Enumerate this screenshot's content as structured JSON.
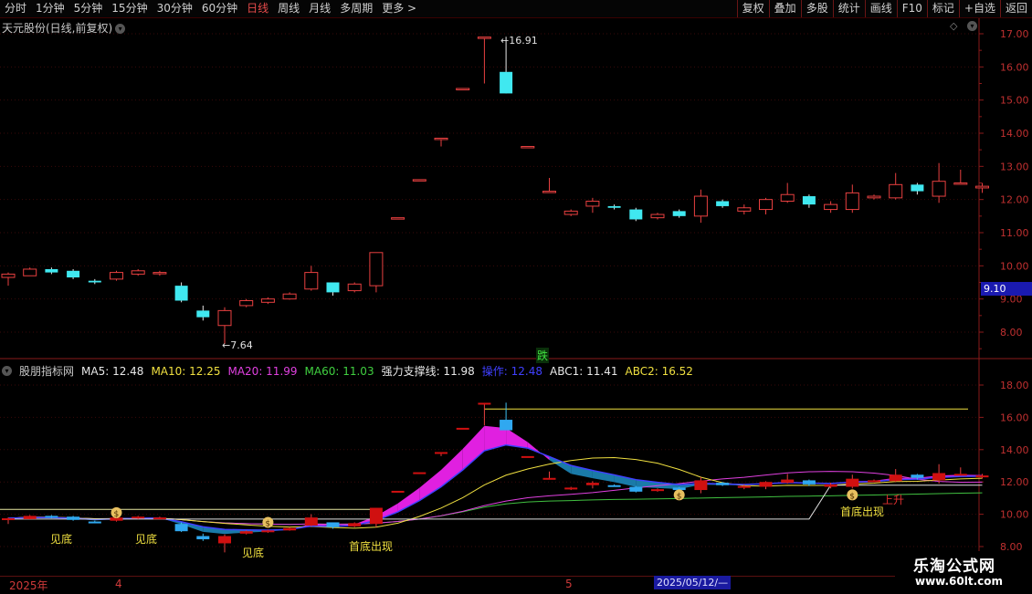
{
  "toolbar": {
    "periods": [
      "分时",
      "1分钟",
      "5分钟",
      "15分钟",
      "30分钟",
      "60分钟",
      "日线",
      "周线",
      "月线",
      "多周期",
      "更多 >"
    ],
    "active_period": "日线",
    "actions": [
      "复权",
      "叠加",
      "多股",
      "统计",
      "画线",
      "F10",
      "标记",
      "+自选",
      "返回"
    ]
  },
  "price_pane": {
    "title": "天元股份(日线,前复权)",
    "y_ticks": [
      "17.00",
      "16.00",
      "15.00",
      "14.00",
      "13.00",
      "12.00",
      "11.00",
      "10.00",
      "9.00",
      "8.00"
    ],
    "high_label": "16.91",
    "low_label": "7.64",
    "current_price": "9.10",
    "signal_text": "跌"
  },
  "indicator_pane": {
    "name": "股朋指标网",
    "values": [
      {
        "label": "MA5: 12.48",
        "color": "#e8e8e8"
      },
      {
        "label": "MA10: 12.25",
        "color": "#f0e040"
      },
      {
        "label": "MA20: 11.99",
        "color": "#e040e0"
      },
      {
        "label": "MA60: 11.03",
        "color": "#40d040"
      },
      {
        "label": "强力支撑线: 11.98",
        "color": "#e8e8e8"
      },
      {
        "label": "操作: 12.48",
        "color": "#4040ff"
      },
      {
        "label": "ABC1: 11.41",
        "color": "#e8e8e8"
      },
      {
        "label": "ABC2: 16.52",
        "color": "#f0e040"
      }
    ],
    "y_ticks": [
      "18.00",
      "16.00",
      "14.00",
      "12.00",
      "10.00",
      "8.00"
    ],
    "signals": [
      {
        "text": "见底",
        "color": "#f0e040"
      },
      {
        "text": "见底",
        "color": "#f0e040"
      },
      {
        "text": "见底",
        "color": "#f0e040"
      },
      {
        "text": "首底出现",
        "color": "#f0e040"
      },
      {
        "text": "首底出现",
        "color": "#f0e040"
      },
      {
        "text": "上升",
        "color": "#e03030"
      }
    ]
  },
  "date_bar": {
    "labels": [
      "2025年",
      "4",
      "5"
    ],
    "highlight": "2025/05/12/—"
  },
  "logo": {
    "line1": "乐淘公式网",
    "line2": "www.60lt.com"
  },
  "chart_data": {
    "type": "candlestick",
    "ylim": [
      7.5,
      17.3
    ],
    "candles": [
      {
        "o": 9.65,
        "h": 9.8,
        "l": 9.4,
        "c": 9.75
      },
      {
        "o": 9.7,
        "h": 9.95,
        "l": 9.7,
        "c": 9.9
      },
      {
        "o": 9.9,
        "h": 9.95,
        "l": 9.75,
        "c": 9.8
      },
      {
        "o": 9.85,
        "h": 9.9,
        "l": 9.6,
        "c": 9.65
      },
      {
        "o": 9.55,
        "h": 9.6,
        "l": 9.45,
        "c": 9.5
      },
      {
        "o": 9.6,
        "h": 9.85,
        "l": 9.55,
        "c": 9.8
      },
      {
        "o": 9.75,
        "h": 9.9,
        "l": 9.7,
        "c": 9.85
      },
      {
        "o": 9.8,
        "h": 9.85,
        "l": 9.7,
        "c": 9.8
      },
      {
        "o": 9.4,
        "h": 9.5,
        "l": 8.9,
        "c": 8.95
      },
      {
        "o": 8.65,
        "h": 8.8,
        "l": 8.35,
        "c": 8.45
      },
      {
        "o": 8.2,
        "h": 8.75,
        "l": 7.64,
        "c": 8.65
      },
      {
        "o": 8.8,
        "h": 9.0,
        "l": 8.75,
        "c": 8.95
      },
      {
        "o": 8.9,
        "h": 9.05,
        "l": 8.85,
        "c": 9.0
      },
      {
        "o": 9.0,
        "h": 9.2,
        "l": 8.98,
        "c": 9.15
      },
      {
        "o": 9.3,
        "h": 10.0,
        "l": 9.25,
        "c": 9.8
      },
      {
        "o": 9.5,
        "h": 9.5,
        "l": 9.1,
        "c": 9.2
      },
      {
        "o": 9.25,
        "h": 9.5,
        "l": 9.2,
        "c": 9.45
      },
      {
        "o": 9.4,
        "h": 10.4,
        "l": 9.2,
        "c": 10.4
      },
      {
        "o": 11.45,
        "h": 11.45,
        "l": 11.45,
        "c": 11.45
      },
      {
        "o": 12.6,
        "h": 12.6,
        "l": 12.6,
        "c": 12.6
      },
      {
        "o": 13.85,
        "h": 13.85,
        "l": 13.6,
        "c": 13.85
      },
      {
        "o": 15.35,
        "h": 15.35,
        "l": 15.35,
        "c": 15.35
      },
      {
        "o": 16.9,
        "h": 16.9,
        "l": 15.5,
        "c": 16.9
      },
      {
        "o": 15.85,
        "h": 16.91,
        "l": 15.2,
        "c": 15.2
      },
      {
        "o": 13.6,
        "h": 13.6,
        "l": 13.6,
        "c": 13.6
      },
      {
        "o": 12.25,
        "h": 12.65,
        "l": 12.2,
        "c": 12.25
      },
      {
        "o": 11.55,
        "h": 11.7,
        "l": 11.5,
        "c": 11.65
      },
      {
        "o": 11.8,
        "h": 12.05,
        "l": 11.6,
        "c": 11.95
      },
      {
        "o": 11.8,
        "h": 11.85,
        "l": 11.7,
        "c": 11.75
      },
      {
        "o": 11.7,
        "h": 11.75,
        "l": 11.35,
        "c": 11.4
      },
      {
        "o": 11.45,
        "h": 11.6,
        "l": 11.4,
        "c": 11.55
      },
      {
        "o": 11.65,
        "h": 11.7,
        "l": 11.45,
        "c": 11.5
      },
      {
        "o": 11.5,
        "h": 12.3,
        "l": 11.3,
        "c": 12.1
      },
      {
        "o": 11.95,
        "h": 12.0,
        "l": 11.75,
        "c": 11.8
      },
      {
        "o": 11.65,
        "h": 11.85,
        "l": 11.55,
        "c": 11.75
      },
      {
        "o": 11.7,
        "h": 12.05,
        "l": 11.55,
        "c": 12.0
      },
      {
        "o": 11.95,
        "h": 12.5,
        "l": 11.9,
        "c": 12.15
      },
      {
        "o": 12.1,
        "h": 12.15,
        "l": 11.75,
        "c": 11.85
      },
      {
        "o": 11.7,
        "h": 11.95,
        "l": 11.6,
        "c": 11.85
      },
      {
        "o": 11.7,
        "h": 12.45,
        "l": 11.6,
        "c": 12.2
      },
      {
        "o": 12.05,
        "h": 12.15,
        "l": 12.0,
        "c": 12.1
      },
      {
        "o": 12.05,
        "h": 12.8,
        "l": 12.0,
        "c": 12.45
      },
      {
        "o": 12.45,
        "h": 12.5,
        "l": 12.15,
        "c": 12.25
      },
      {
        "o": 12.1,
        "h": 13.1,
        "l": 11.9,
        "c": 12.55
      },
      {
        "o": 12.5,
        "h": 12.9,
        "l": 12.45,
        "c": 12.5
      },
      {
        "o": 12.35,
        "h": 12.5,
        "l": 12.2,
        "c": 12.4
      }
    ]
  }
}
